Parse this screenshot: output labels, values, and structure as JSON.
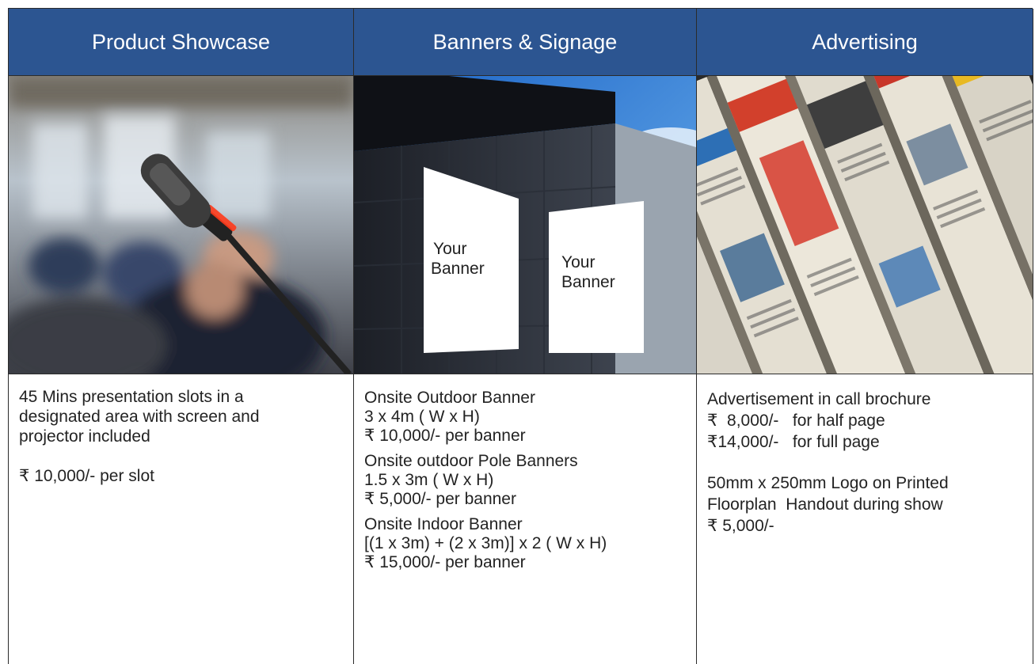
{
  "columns": [
    {
      "heading": "Product Showcase",
      "image": "conference-microphone-photo",
      "lines": [
        "45 Mins presentation slots in a",
        "designated area with screen and",
        "projector included"
      ],
      "price": "₹ 10,000/- per slot"
    },
    {
      "heading": "Banners & Signage",
      "image": "building-banner-mockup-photo",
      "banner_label_left": "Your\nBanner",
      "banner_label_right": "Your\nBanner",
      "items": [
        {
          "title": "Onsite Outdoor Banner",
          "size": "3 x 4m ( W x H)",
          "price": "₹ 10,000/- per banner"
        },
        {
          "title": "Onsite outdoor Pole Banners",
          "size": "1.5 x 3m ( W x H)",
          "price": "₹ 5,000/- per banner"
        },
        {
          "title": "Onsite Indoor Banner",
          "size": "[(1 x 3m) + (2 x 3m)] x 2 ( W x H)",
          "price": "₹ 15,000/- per banner"
        }
      ]
    },
    {
      "heading": "Advertising",
      "image": "rolled-newspapers-photo",
      "title": "Advertisement in call brochure",
      "half_page": "₹  8,000/-   for half page",
      "full_page": "₹14,000/-   for full page",
      "logo_line1": "50mm x 250mm Logo on Printed",
      "logo_line2": "Floorplan  Handout during show",
      "logo_price": "₹ 5,000/-"
    }
  ],
  "colors": {
    "header_bg": "#2c5591",
    "header_text": "#ffffff",
    "border": "#2b2b2b"
  }
}
